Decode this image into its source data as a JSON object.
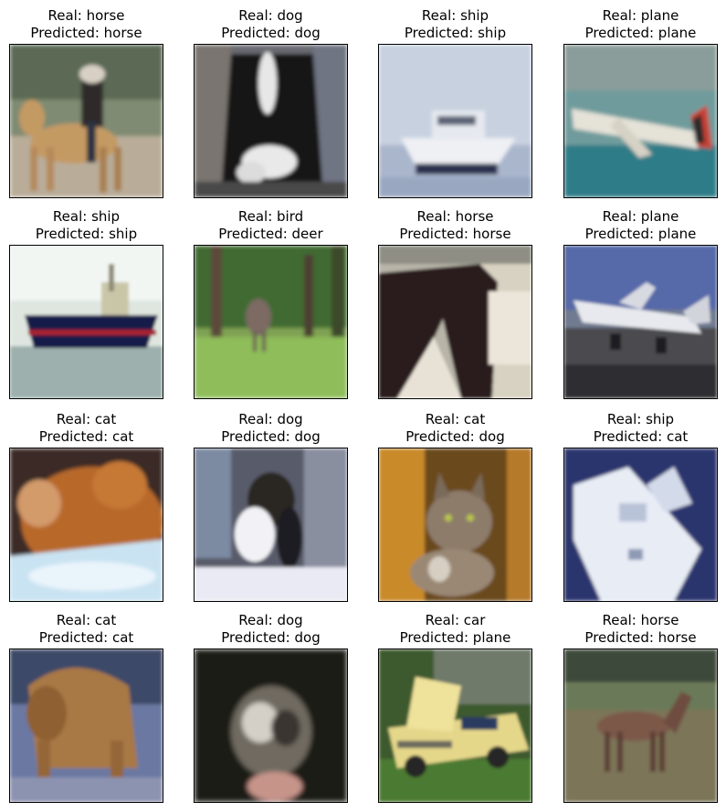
{
  "figure": {
    "panels": [
      {
        "real_label": "Real: horse",
        "pred_label": "Predicted: horse",
        "scene": "horse-rider"
      },
      {
        "real_label": "Real: dog",
        "pred_label": "Predicted: dog",
        "scene": "dog-bw"
      },
      {
        "real_label": "Real: ship",
        "pred_label": "Predicted: ship",
        "scene": "boat-white"
      },
      {
        "real_label": "Real: plane",
        "pred_label": "Predicted: plane",
        "scene": "plane-teal"
      },
      {
        "real_label": "Real: ship",
        "pred_label": "Predicted: ship",
        "scene": "ship-blue-hull"
      },
      {
        "real_label": "Real: bird",
        "pred_label": "Predicted: deer",
        "scene": "ostrich-grass"
      },
      {
        "real_label": "Real: horse",
        "pred_label": "Predicted: horse",
        "scene": "horse-dark"
      },
      {
        "real_label": "Real: plane",
        "pred_label": "Predicted: plane",
        "scene": "plane-runway"
      },
      {
        "real_label": "Real: cat",
        "pred_label": "Predicted: cat",
        "scene": "cat-orange"
      },
      {
        "real_label": "Real: dog",
        "pred_label": "Predicted: dog",
        "scene": "dog-window"
      },
      {
        "real_label": "Real: cat",
        "pred_label": "Predicted: dog",
        "scene": "cat-tabby"
      },
      {
        "real_label": "Real: ship",
        "pred_label": "Predicted: cat",
        "scene": "boat-blue"
      },
      {
        "real_label": "Real: cat",
        "pred_label": "Predicted: cat",
        "scene": "cat-arched"
      },
      {
        "real_label": "Real: dog",
        "pred_label": "Predicted: dog",
        "scene": "dog-dark"
      },
      {
        "real_label": "Real: car",
        "pred_label": "Predicted: plane",
        "scene": "car-yellow"
      },
      {
        "real_label": "Real: horse",
        "pred_label": "Predicted: horse",
        "scene": "horse-field"
      }
    ]
  }
}
